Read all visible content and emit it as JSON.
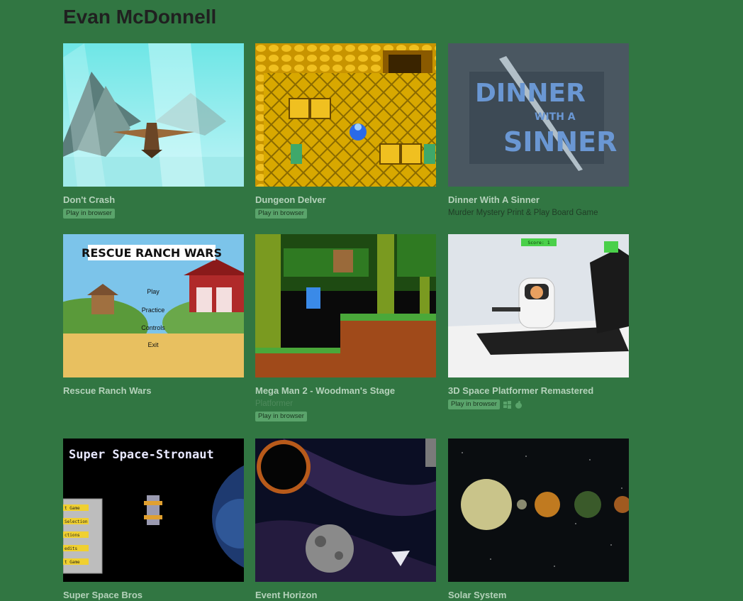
{
  "page": {
    "author": "Evan McDonnell"
  },
  "games": [
    {
      "title": "Don't Crash",
      "badge": "Play in browser"
    },
    {
      "title": "Dungeon Delver",
      "badge": "Play in browser"
    },
    {
      "title": "Dinner With A Sinner",
      "subtitle": "Murder Mystery Print & Play Board Game",
      "thumb_text": [
        "DINNER",
        "WITH A",
        "SINNER"
      ]
    },
    {
      "title": "Rescue Ranch Wars",
      "thumb_text": {
        "heading": "RESCUE RANCH WARS",
        "menu": [
          "Play",
          "Practice",
          "Controls",
          "Exit"
        ]
      }
    },
    {
      "title": "Mega Man 2 - Woodman's Stage",
      "subtitle": "Platformer",
      "badge": "Play in browser"
    },
    {
      "title": "3D Space Platformer Remastered",
      "badge": "Play in browser",
      "platforms": [
        "windows-icon",
        "apple-icon"
      ],
      "thumb_text": {
        "score": "Score: 1"
      }
    },
    {
      "title": "Super Space Bros",
      "thumb_text": {
        "heading": "Super Space-Stronaut",
        "menu": [
          "t Game",
          "Selection",
          "ctions",
          "edits",
          "t Game"
        ]
      }
    },
    {
      "title": "Event Horizon"
    },
    {
      "title": "Solar System"
    }
  ],
  "colors": {
    "background": "#317642",
    "title_link": "#b5d2bb",
    "badge": "#5aa46b"
  }
}
